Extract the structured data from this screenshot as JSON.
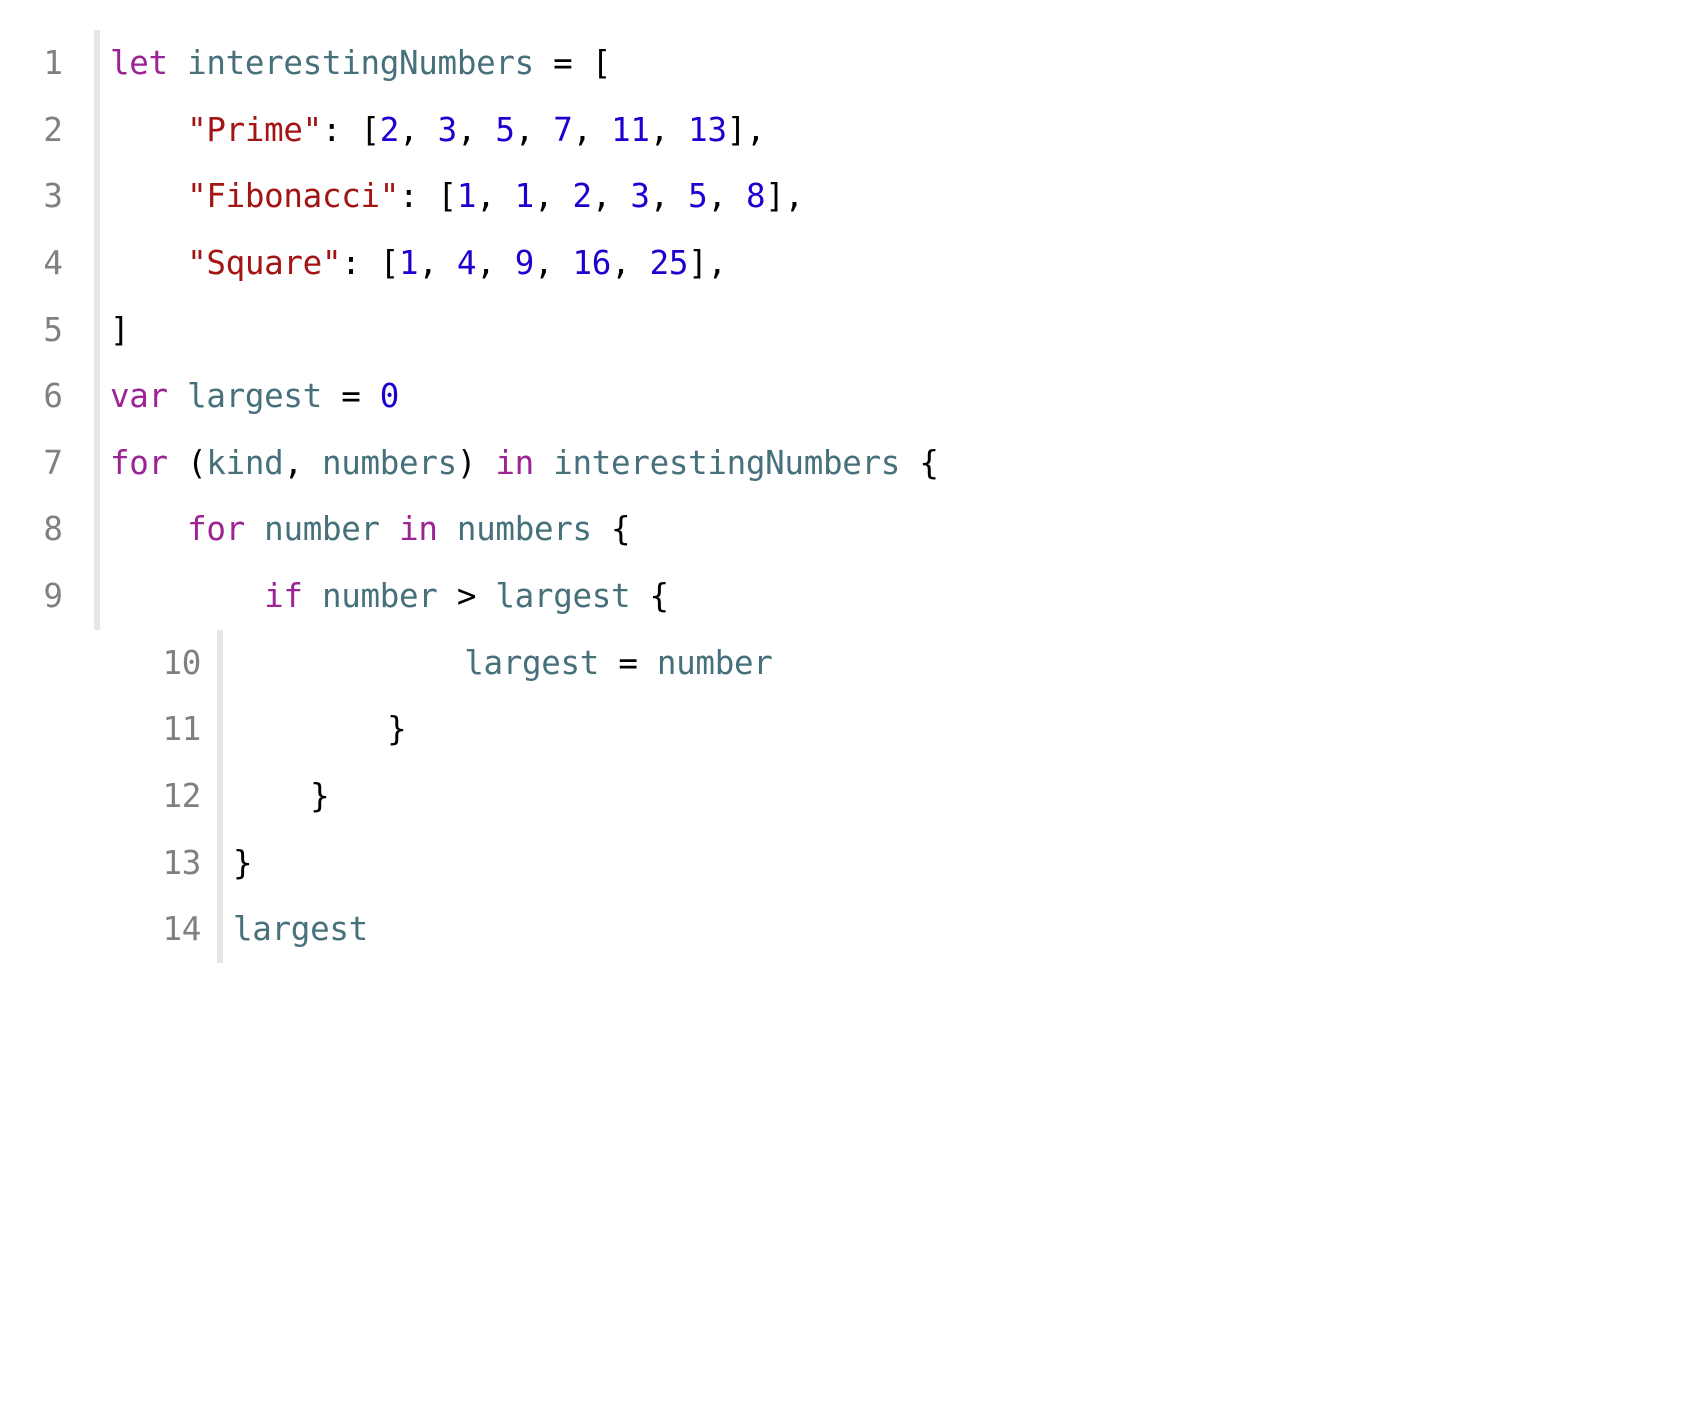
{
  "language": "swift",
  "lines": [
    {
      "n": "1",
      "gutter": "A",
      "tokens": [
        [
          "kw",
          "let"
        ],
        [
          "p",
          " "
        ],
        [
          "id",
          "interestingNumbers"
        ],
        [
          "p",
          " = ["
        ]
      ]
    },
    {
      "n": "2",
      "gutter": "A",
      "tokens": [
        [
          "p",
          "    "
        ],
        [
          "str",
          "\"Prime\""
        ],
        [
          "p",
          ": ["
        ],
        [
          "num",
          "2"
        ],
        [
          "p",
          ", "
        ],
        [
          "num",
          "3"
        ],
        [
          "p",
          ", "
        ],
        [
          "num",
          "5"
        ],
        [
          "p",
          ", "
        ],
        [
          "num",
          "7"
        ],
        [
          "p",
          ", "
        ],
        [
          "num",
          "11"
        ],
        [
          "p",
          ", "
        ],
        [
          "num",
          "13"
        ],
        [
          "p",
          "],"
        ]
      ]
    },
    {
      "n": "3",
      "gutter": "A",
      "tokens": [
        [
          "p",
          "    "
        ],
        [
          "str",
          "\"Fibonacci\""
        ],
        [
          "p",
          ": ["
        ],
        [
          "num",
          "1"
        ],
        [
          "p",
          ", "
        ],
        [
          "num",
          "1"
        ],
        [
          "p",
          ", "
        ],
        [
          "num",
          "2"
        ],
        [
          "p",
          ", "
        ],
        [
          "num",
          "3"
        ],
        [
          "p",
          ", "
        ],
        [
          "num",
          "5"
        ],
        [
          "p",
          ", "
        ],
        [
          "num",
          "8"
        ],
        [
          "p",
          "],"
        ]
      ]
    },
    {
      "n": "4",
      "gutter": "A",
      "tokens": [
        [
          "p",
          "    "
        ],
        [
          "str",
          "\"Square\""
        ],
        [
          "p",
          ": ["
        ],
        [
          "num",
          "1"
        ],
        [
          "p",
          ", "
        ],
        [
          "num",
          "4"
        ],
        [
          "p",
          ", "
        ],
        [
          "num",
          "9"
        ],
        [
          "p",
          ", "
        ],
        [
          "num",
          "16"
        ],
        [
          "p",
          ", "
        ],
        [
          "num",
          "25"
        ],
        [
          "p",
          "],"
        ]
      ]
    },
    {
      "n": "5",
      "gutter": "A",
      "tokens": [
        [
          "p",
          "]"
        ]
      ]
    },
    {
      "n": "6",
      "gutter": "A",
      "tokens": [
        [
          "kw",
          "var"
        ],
        [
          "p",
          " "
        ],
        [
          "id",
          "largest"
        ],
        [
          "p",
          " = "
        ],
        [
          "num",
          "0"
        ]
      ]
    },
    {
      "n": "7",
      "gutter": "A",
      "tokens": [
        [
          "kw",
          "for"
        ],
        [
          "p",
          " ("
        ],
        [
          "id",
          "kind"
        ],
        [
          "p",
          ", "
        ],
        [
          "id",
          "numbers"
        ],
        [
          "p",
          ") "
        ],
        [
          "kw",
          "in"
        ],
        [
          "p",
          " "
        ],
        [
          "id",
          "interestingNumbers"
        ],
        [
          "p",
          " {"
        ]
      ]
    },
    {
      "n": "8",
      "gutter": "A",
      "tokens": [
        [
          "p",
          "    "
        ],
        [
          "kw",
          "for"
        ],
        [
          "p",
          " "
        ],
        [
          "id",
          "number"
        ],
        [
          "p",
          " "
        ],
        [
          "kw",
          "in"
        ],
        [
          "p",
          " "
        ],
        [
          "id",
          "numbers"
        ],
        [
          "p",
          " {"
        ]
      ]
    },
    {
      "n": "9",
      "gutter": "A",
      "tokens": [
        [
          "p",
          "        "
        ],
        [
          "kw",
          "if"
        ],
        [
          "p",
          " "
        ],
        [
          "id",
          "number"
        ],
        [
          "p",
          " > "
        ],
        [
          "id",
          "largest"
        ],
        [
          "p",
          " {"
        ]
      ]
    },
    {
      "n": "10",
      "gutter": "B",
      "tokens": [
        [
          "p",
          "            "
        ],
        [
          "id",
          "largest"
        ],
        [
          "p",
          " = "
        ],
        [
          "id",
          "number"
        ]
      ]
    },
    {
      "n": "11",
      "gutter": "B",
      "tokens": [
        [
          "p",
          "        }"
        ]
      ]
    },
    {
      "n": "12",
      "gutter": "B",
      "tokens": [
        [
          "p",
          "    }"
        ]
      ]
    },
    {
      "n": "13",
      "gutter": "B",
      "tokens": [
        [
          "p",
          "}"
        ]
      ]
    },
    {
      "n": "14",
      "gutter": "B",
      "tokens": [
        [
          "id",
          "largest"
        ]
      ]
    }
  ]
}
